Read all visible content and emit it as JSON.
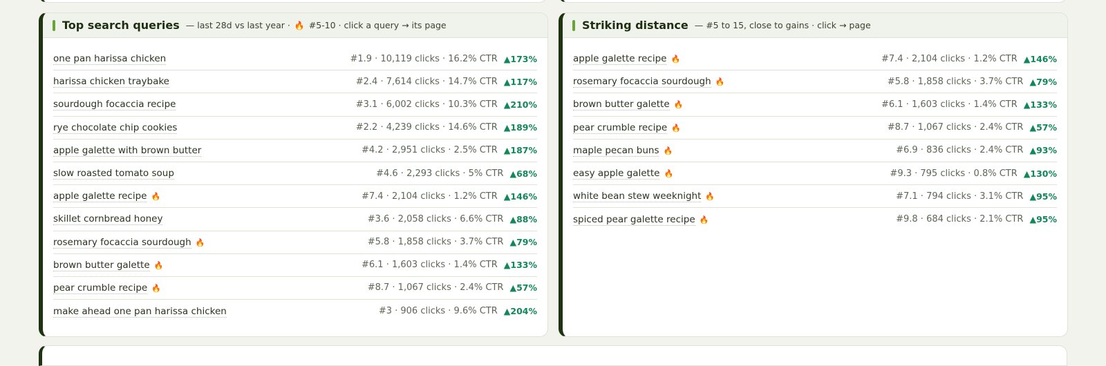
{
  "top_queries": {
    "title": "Top search queries",
    "subtitle_pre": "— last 28d vs last year ·",
    "subtitle_flame": "🔥",
    "subtitle_post": "#5-10 · click a query → its page",
    "rows": [
      {
        "query": "one pan harissa chicken",
        "flame": "",
        "stats": "#1.9 · 10,119 clicks · 16.2% CTR",
        "delta": "▲173%"
      },
      {
        "query": "harissa chicken traybake",
        "flame": "",
        "stats": "#2.4 · 7,614 clicks · 14.7% CTR",
        "delta": "▲117%"
      },
      {
        "query": "sourdough focaccia recipe",
        "flame": "",
        "stats": "#3.1 · 6,002 clicks · 10.3% CTR",
        "delta": "▲210%"
      },
      {
        "query": "rye chocolate chip cookies",
        "flame": "",
        "stats": "#2.2 · 4,239 clicks · 14.6% CTR",
        "delta": "▲189%"
      },
      {
        "query": "apple galette with brown butter",
        "flame": "",
        "stats": "#4.2 · 2,951 clicks · 2.5% CTR",
        "delta": "▲187%"
      },
      {
        "query": "slow roasted tomato soup",
        "flame": "",
        "stats": "#4.6 · 2,293 clicks · 5% CTR",
        "delta": "▲68%"
      },
      {
        "query": "apple galette recipe",
        "flame": "🔥",
        "stats": "#7.4 · 2,104 clicks · 1.2% CTR",
        "delta": "▲146%"
      },
      {
        "query": "skillet cornbread honey",
        "flame": "",
        "stats": "#3.6 · 2,058 clicks · 6.6% CTR",
        "delta": "▲88%"
      },
      {
        "query": "rosemary focaccia sourdough",
        "flame": "🔥",
        "stats": "#5.8 · 1,858 clicks · 3.7% CTR",
        "delta": "▲79%"
      },
      {
        "query": "brown butter galette",
        "flame": "🔥",
        "stats": "#6.1 · 1,603 clicks · 1.4% CTR",
        "delta": "▲133%"
      },
      {
        "query": "pear crumble recipe",
        "flame": "🔥",
        "stats": "#8.7 · 1,067 clicks · 2.4% CTR",
        "delta": "▲57%"
      },
      {
        "query": "make ahead one pan harissa chicken",
        "flame": "",
        "stats": "#3 · 906 clicks · 9.6% CTR",
        "delta": "▲204%"
      }
    ]
  },
  "striking": {
    "title": "Striking distance",
    "subtitle": "— #5 to 15, close to gains · click → page",
    "rows": [
      {
        "query": "apple galette recipe",
        "flame": "🔥",
        "stats": "#7.4 · 2,104 clicks · 1.2% CTR",
        "delta": "▲146%"
      },
      {
        "query": "rosemary focaccia sourdough",
        "flame": "🔥",
        "stats": "#5.8 · 1,858 clicks · 3.7% CTR",
        "delta": "▲79%"
      },
      {
        "query": "brown butter galette",
        "flame": "🔥",
        "stats": "#6.1 · 1,603 clicks · 1.4% CTR",
        "delta": "▲133%"
      },
      {
        "query": "pear crumble recipe",
        "flame": "🔥",
        "stats": "#8.7 · 1,067 clicks · 2.4% CTR",
        "delta": "▲57%"
      },
      {
        "query": "maple pecan buns",
        "flame": "🔥",
        "stats": "#6.9 · 836 clicks · 2.4% CTR",
        "delta": "▲93%"
      },
      {
        "query": "easy apple galette",
        "flame": "🔥",
        "stats": "#9.3 · 795 clicks · 0.8% CTR",
        "delta": "▲130%"
      },
      {
        "query": "white bean stew weeknight",
        "flame": "🔥",
        "stats": "#7.1 · 794 clicks · 3.1% CTR",
        "delta": "▲95%"
      },
      {
        "query": "spiced pear galette recipe",
        "flame": "🔥",
        "stats": "#9.8 · 684 clicks · 2.1% CTR",
        "delta": "▲95%"
      }
    ]
  },
  "colors": {
    "accent": "#6aa33a",
    "panel_border": "#1e3312",
    "delta": "#12875a"
  }
}
